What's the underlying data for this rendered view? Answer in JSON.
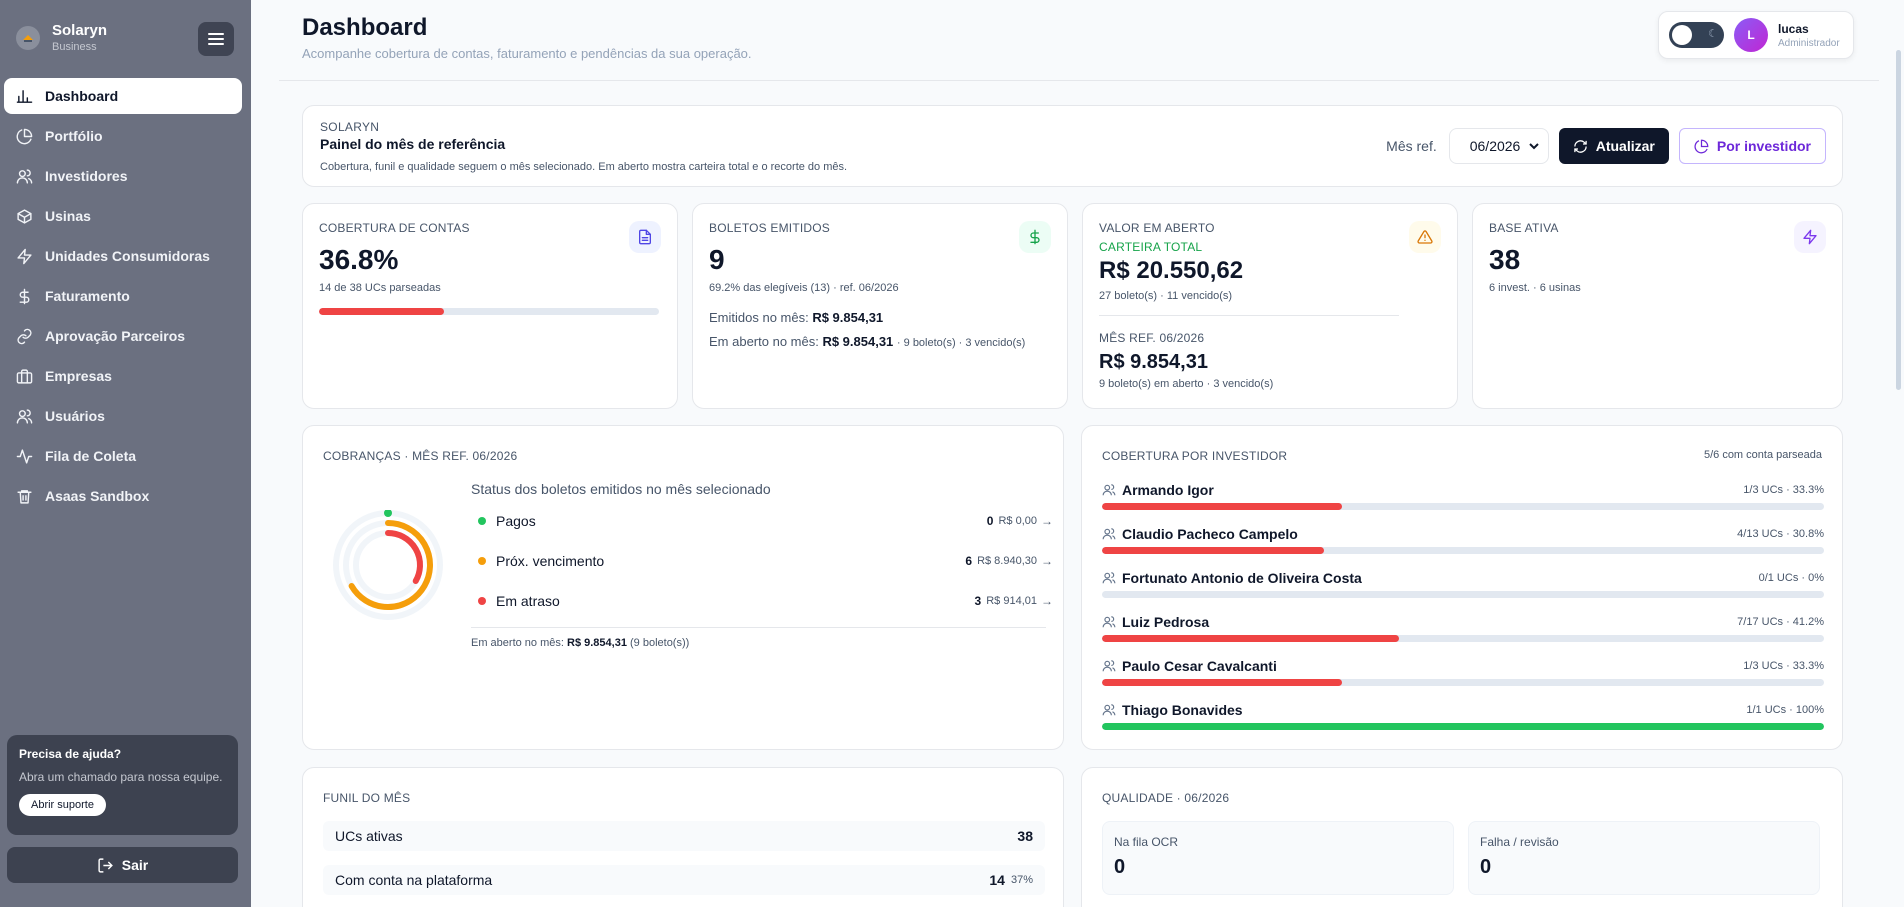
{
  "sidebar": {
    "brand_name": "Solaryn",
    "brand_sub": "Business",
    "items": [
      {
        "label": "Dashboard",
        "icon": "bar-chart-icon"
      },
      {
        "label": "Portfólio",
        "icon": "pie-chart-icon"
      },
      {
        "label": "Investidores",
        "icon": "users-icon"
      },
      {
        "label": "Usinas",
        "icon": "box-icon"
      },
      {
        "label": "Unidades Consumidoras",
        "icon": "zap-icon"
      },
      {
        "label": "Faturamento",
        "icon": "dollar-icon"
      },
      {
        "label": "Aprovação Parceiros",
        "icon": "link-icon"
      },
      {
        "label": "Empresas",
        "icon": "briefcase-icon"
      },
      {
        "label": "Usuários",
        "icon": "users-icon"
      },
      {
        "label": "Fila de Coleta",
        "icon": "activity-icon"
      },
      {
        "label": "Asaas Sandbox",
        "icon": "trash-icon"
      }
    ],
    "help_title": "Precisa de ajuda?",
    "help_text": "Abra um chamado para nossa equipe.",
    "help_button": "Abrir suporte",
    "logout_label": "Sair"
  },
  "header": {
    "title": "Dashboard",
    "subtitle": "Acompanhe cobertura de contas, faturamento e pendências da sua operação.",
    "user_name": "lucas",
    "user_role": "Administrador",
    "avatar_initial": "L"
  },
  "ref_panel": {
    "kicker": "SOLARYN",
    "title": "Painel do mês de referência",
    "description": "Cobertura, funil e qualidade seguem o mês selecionado. Em aberto mostra carteira total e o recorte do mês.",
    "month_label": "Mês ref.",
    "month_value": "06/2026",
    "refresh_label": "Atualizar",
    "investor_label": "Por investidor"
  },
  "kpis": {
    "cobertura": {
      "label": "COBERTURA DE CONTAS",
      "value": "36.8%",
      "sub": "14 de 38 UCs parseadas",
      "progress": 0.368
    },
    "boletos": {
      "label": "BOLETOS EMITIDOS",
      "value": "9",
      "sub": "69.2% das elegíveis (13) · ref. 06/2026",
      "emitidos_label": "Emitidos no mês:",
      "emitidos_value": "R$ 9.854,31",
      "aberto_label": "Em aberto no mês:",
      "aberto_value": "R$ 9.854,31",
      "aberto_detail": "· 9 boleto(s) · 3 vencido(s)"
    },
    "valor_aberto": {
      "label": "VALOR EM ABERTO",
      "tag": "CARTEIRA TOTAL",
      "value": "R$ 20.550,62",
      "sub": "27 boleto(s) · 11 vencido(s)",
      "month_label": "MÊS REF. 06/2026",
      "month_value": "R$ 9.854,31",
      "month_sub": "9 boleto(s) em aberto · 3 vencido(s)"
    },
    "base": {
      "label": "BASE ATIVA",
      "value": "38",
      "sub": "6 invest. · 6 usinas"
    }
  },
  "cobrancas": {
    "title": "COBRANÇAS · MÊS REF. 06/2026",
    "legend_title": "Status dos boletos emitidos no mês selecionado",
    "rows": [
      {
        "name": "Pagos",
        "count": "0",
        "amount": "R$ 0,00",
        "color": "#22c55e"
      },
      {
        "name": "Próx. vencimento",
        "count": "6",
        "amount": "R$ 8.940,30",
        "color": "#f59e0b"
      },
      {
        "name": "Em atraso",
        "count": "3",
        "amount": "R$ 914,01",
        "color": "#ef4444"
      }
    ],
    "footer_label": "Em aberto no mês:",
    "footer_value": "R$ 9.854,31",
    "footer_detail": "(9 boleto(s))"
  },
  "cobertura_investidor": {
    "title": "COBERTURA POR INVESTIDOR",
    "summary": "5/6 com conta parseada",
    "rows": [
      {
        "name": "Armando Igor",
        "meta": "1/3 UCs · 33.3%",
        "pct": 0.333,
        "color": "#ef4444"
      },
      {
        "name": "Claudio Pacheco Campelo",
        "meta": "4/13 UCs · 30.8%",
        "pct": 0.308,
        "color": "#ef4444"
      },
      {
        "name": "Fortunato Antonio de Oliveira Costa",
        "meta": "0/1 UCs · 0%",
        "pct": 0,
        "color": "#ef4444"
      },
      {
        "name": "Luiz Pedrosa",
        "meta": "7/17 UCs · 41.2%",
        "pct": 0.412,
        "color": "#ef4444"
      },
      {
        "name": "Paulo Cesar Cavalcanti",
        "meta": "1/3 UCs · 33.3%",
        "pct": 0.333,
        "color": "#ef4444"
      },
      {
        "name": "Thiago Bonavides",
        "meta": "1/1 UCs · 100%",
        "pct": 1,
        "color": "#22c55e"
      }
    ]
  },
  "funil": {
    "title": "FUNIL DO MÊS",
    "rows": [
      {
        "label": "UCs ativas",
        "value": "38",
        "pct": ""
      },
      {
        "label": "Com conta na plataforma",
        "value": "14",
        "pct": "37%"
      }
    ]
  },
  "qualidade": {
    "title": "QUALIDADE · 06/2026",
    "boxes": [
      {
        "label": "Na fila OCR",
        "value": "0"
      },
      {
        "label": "Falha / revisão",
        "value": "0"
      }
    ]
  }
}
